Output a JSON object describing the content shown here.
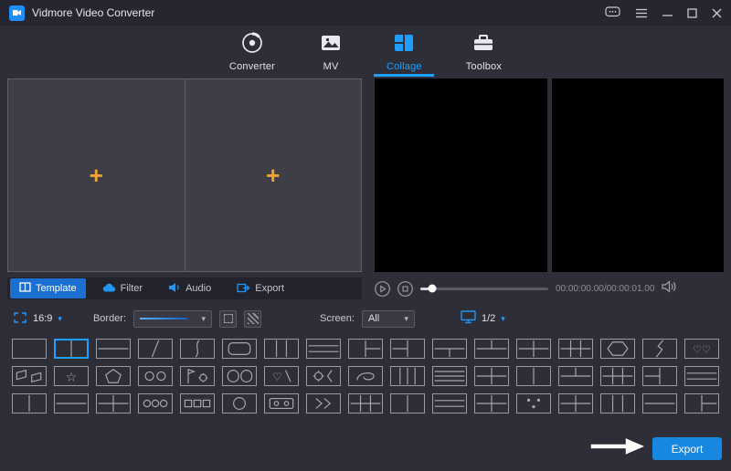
{
  "titlebar": {
    "title": "Vidmore Video Converter"
  },
  "nav": {
    "tabs": [
      {
        "label": "Converter"
      },
      {
        "label": "MV"
      },
      {
        "label": "Collage"
      },
      {
        "label": "Toolbox"
      }
    ]
  },
  "editor": {
    "plus": "+"
  },
  "subtabs": {
    "items": [
      {
        "label": "Template"
      },
      {
        "label": "Filter"
      },
      {
        "label": "Audio"
      },
      {
        "label": "Export"
      }
    ]
  },
  "player": {
    "time": "00:00:00.00/00:00:01.00"
  },
  "toolbar": {
    "ratio": "16:9",
    "border_label": "Border:",
    "screen_label": "Screen:",
    "screen_value": "All",
    "page": "1/2"
  },
  "footer": {
    "export_label": "Export"
  },
  "colors": {
    "accent": "#1e9fff",
    "plus": "#f0a431",
    "export_button": "#1787e0"
  },
  "templates": {
    "selected": [
      0,
      1
    ],
    "rows": [
      [
        "blank",
        "v2",
        "h2",
        "diag",
        "curve",
        "rounded",
        "v3",
        "h3",
        "l1r2",
        "l2r1",
        "t1b2",
        "t2b1",
        "grid4",
        "grid6",
        "hexagon",
        "zigzag",
        "hearts"
      ],
      [
        "banner",
        "star",
        "pentagon",
        "circles2",
        "flaggear",
        "oo",
        "heartcut",
        "gearangle",
        "swirl",
        "v4",
        "h4",
        "grid4",
        "v2",
        "t2b1",
        "grid6",
        "l2r1",
        "h3"
      ],
      [
        "v2",
        "h2",
        "grid4",
        "circles3",
        "squares3",
        "circle1",
        "tape",
        "ffwd",
        "grid6",
        "v2",
        "h3",
        "grid4",
        "dots",
        "grid4",
        "v3",
        "h2",
        "l1r2"
      ]
    ]
  }
}
